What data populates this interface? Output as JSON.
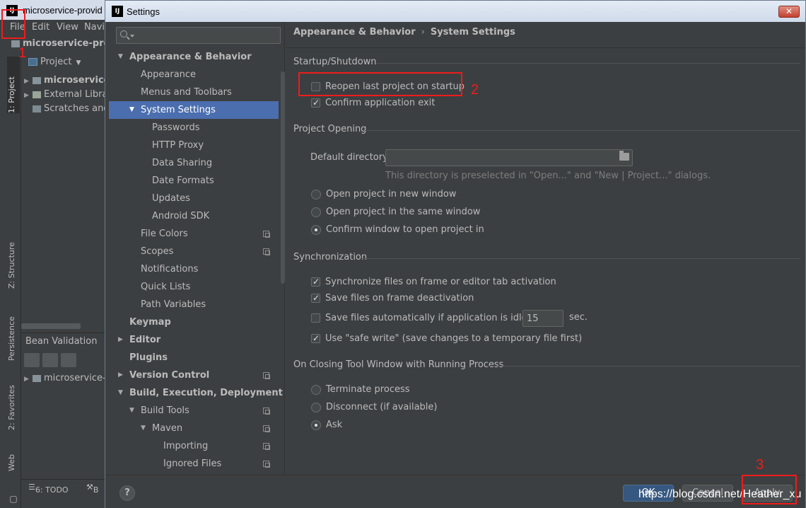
{
  "ide": {
    "window_title": "microservice-provid",
    "menu": [
      "File",
      "Edit",
      "View",
      "Navi"
    ],
    "path_title": "microservice-prov",
    "project_label": "Project",
    "tree": [
      "microservice",
      "External Libra",
      "Scratches and"
    ],
    "side_tabs": [
      "1: Project",
      "Z: Structure",
      "Persistence",
      "2: Favorites",
      "Web"
    ],
    "bean_panel_title": "Bean Validation",
    "bean_tree_item": "microservice-",
    "bottom_todo": "6: TODO",
    "bottom_b": "B"
  },
  "annotations": [
    "1",
    "2",
    "3"
  ],
  "dialog": {
    "title": "Settings",
    "close_label": "✕",
    "search": {
      "value": "",
      "placeholder": ""
    },
    "tree": [
      "Appearance & Behavior",
      "Appearance",
      "Menus and Toolbars",
      "System Settings",
      "Passwords",
      "HTTP Proxy",
      "Data Sharing",
      "Date Formats",
      "Updates",
      "Android SDK",
      "File Colors",
      "Scopes",
      "Notifications",
      "Quick Lists",
      "Path Variables",
      "Keymap",
      "Editor",
      "Plugins",
      "Version Control",
      "Build, Execution, Deployment",
      "Build Tools",
      "Maven",
      "Importing",
      "Ignored Files"
    ],
    "breadcrumb": [
      "Appearance & Behavior",
      "System Settings"
    ],
    "breadcrumb_sep": "›",
    "sections": {
      "startup": {
        "title": "Startup/Shutdown",
        "reopen_last_project": {
          "label": "Reopen last project on startup",
          "checked": false
        },
        "confirm_exit": {
          "label": "Confirm application exit",
          "checked": true
        }
      },
      "project_opening": {
        "title": "Project Opening",
        "default_dir_label": "Default directory:",
        "default_dir_value": "",
        "hint": "This directory is preselected in \"Open...\" and \"New | Project...\" dialogs.",
        "options": [
          "Open project in new window",
          "Open project in the same window",
          "Confirm window to open project in"
        ],
        "selected": 2
      },
      "sync": {
        "title": "Synchronization",
        "on_frame_activation": {
          "label": "Synchronize files on frame or editor tab activation",
          "checked": true
        },
        "on_frame_deactivation": {
          "label": "Save files on frame deactivation",
          "checked": true
        },
        "auto_save": {
          "label": "Save files automatically if application is idle for",
          "checked": false,
          "value": "15",
          "unit": "sec."
        },
        "safe_write": {
          "label": "Use \"safe write\" (save changes to a temporary file first)",
          "checked": true
        }
      },
      "closing": {
        "title": "On Closing Tool Window with Running Process",
        "options": [
          "Terminate process",
          "Disconnect (if available)",
          "Ask"
        ],
        "selected": 2
      }
    },
    "footer": {
      "help": "?",
      "ok": "OK",
      "cancel": "Cancel",
      "apply": "Apply",
      "watermark": "https://blog.csdn.net/Heather_xu"
    }
  },
  "colors": {
    "selection": "#4b6eaf",
    "annotation": "#ee1c1c",
    "background": "#3c3f41"
  }
}
